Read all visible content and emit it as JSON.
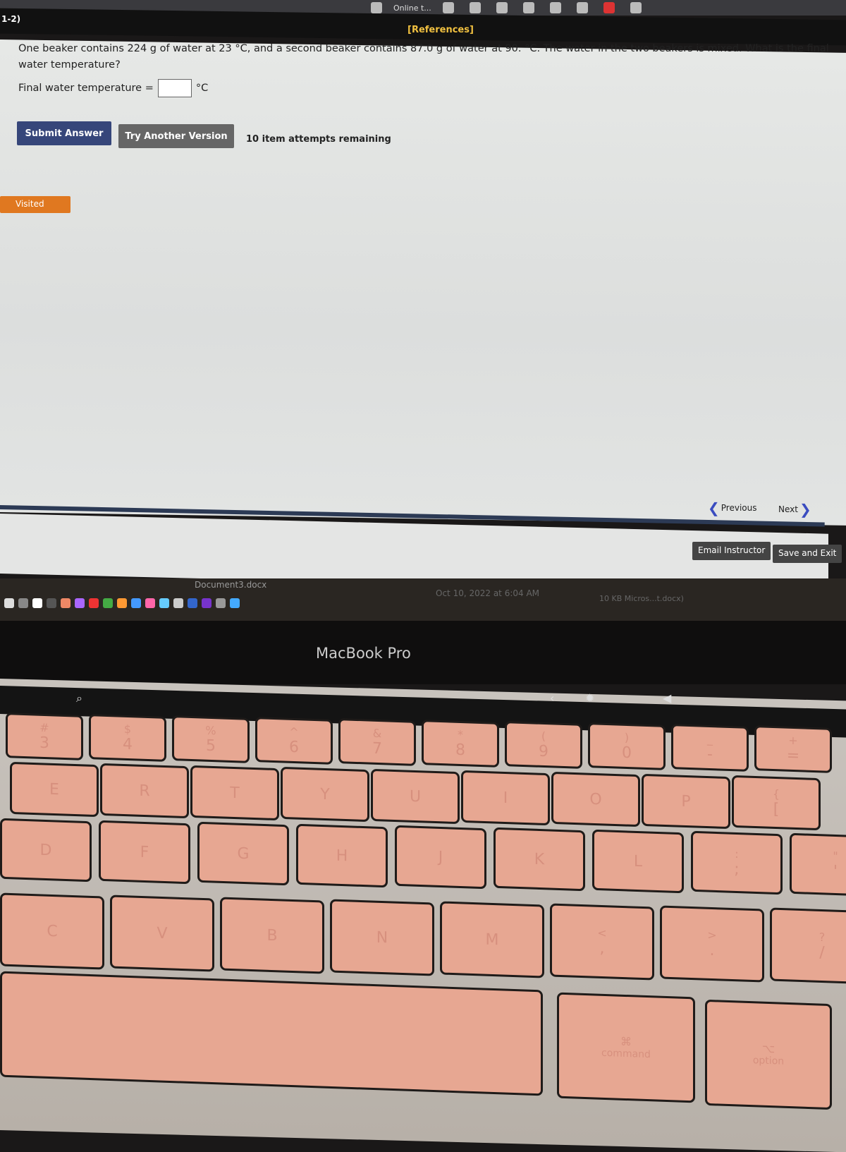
{
  "browser": {
    "tab_label": "Online t..."
  },
  "header": {
    "section": "1-2)",
    "references": "[References]"
  },
  "question": {
    "text": "One beaker contains 224 g of water at 23 °C, and a second beaker contains 87.0 g of water at 90. °C. The water in the two beakers is mixed. What is the final water temperature?",
    "answer_label": "Final water temperature =",
    "answer_value": "",
    "unit": "°C"
  },
  "actions": {
    "submit": "Submit Answer",
    "try_another": "Try Another Version",
    "attempts": "10 item attempts remaining"
  },
  "visited": "Visited",
  "footer": {
    "previous": "Previous",
    "next": "Next",
    "email": "Email Instructor",
    "save_exit": "Save and Exit"
  },
  "dock": {
    "document": "Document3.docx",
    "date": "Oct 10, 2022 at 6:04 AM",
    "size": "10 KB",
    "kind": "Micros...t.docx)"
  },
  "laptop": {
    "brand": "MacBook Pro"
  },
  "keyboard": {
    "row1": [
      [
        "#",
        "3"
      ],
      [
        "$",
        "4"
      ],
      [
        "%",
        "5"
      ],
      [
        "^",
        "6"
      ],
      [
        "&",
        "7"
      ],
      [
        "*",
        "8"
      ],
      [
        "(",
        "9"
      ],
      [
        ")",
        "0"
      ],
      [
        "_",
        "-"
      ],
      [
        "+",
        "="
      ]
    ],
    "row2": [
      [
        "",
        "E"
      ],
      [
        "",
        "R"
      ],
      [
        "",
        "T"
      ],
      [
        "",
        "Y"
      ],
      [
        "",
        "U"
      ],
      [
        "",
        "I"
      ],
      [
        "",
        "O"
      ],
      [
        "",
        "P"
      ],
      [
        "{",
        "["
      ]
    ],
    "row3": [
      [
        "",
        "D"
      ],
      [
        "",
        "F"
      ],
      [
        "",
        "G"
      ],
      [
        "",
        "H"
      ],
      [
        "",
        "J"
      ],
      [
        "",
        "K"
      ],
      [
        "",
        "L"
      ],
      [
        ":",
        ";"
      ],
      [
        "\"",
        "'"
      ]
    ],
    "row4": [
      [
        "",
        "C"
      ],
      [
        "",
        "V"
      ],
      [
        "",
        "B"
      ],
      [
        "",
        "N"
      ],
      [
        "",
        "M"
      ],
      [
        "<",
        ","
      ],
      [
        ">",
        "."
      ],
      [
        "?",
        "/"
      ]
    ],
    "row5": [
      [
        "",
        ""
      ],
      [
        "⌘",
        "command"
      ],
      [
        "⌥",
        "option"
      ]
    ]
  }
}
